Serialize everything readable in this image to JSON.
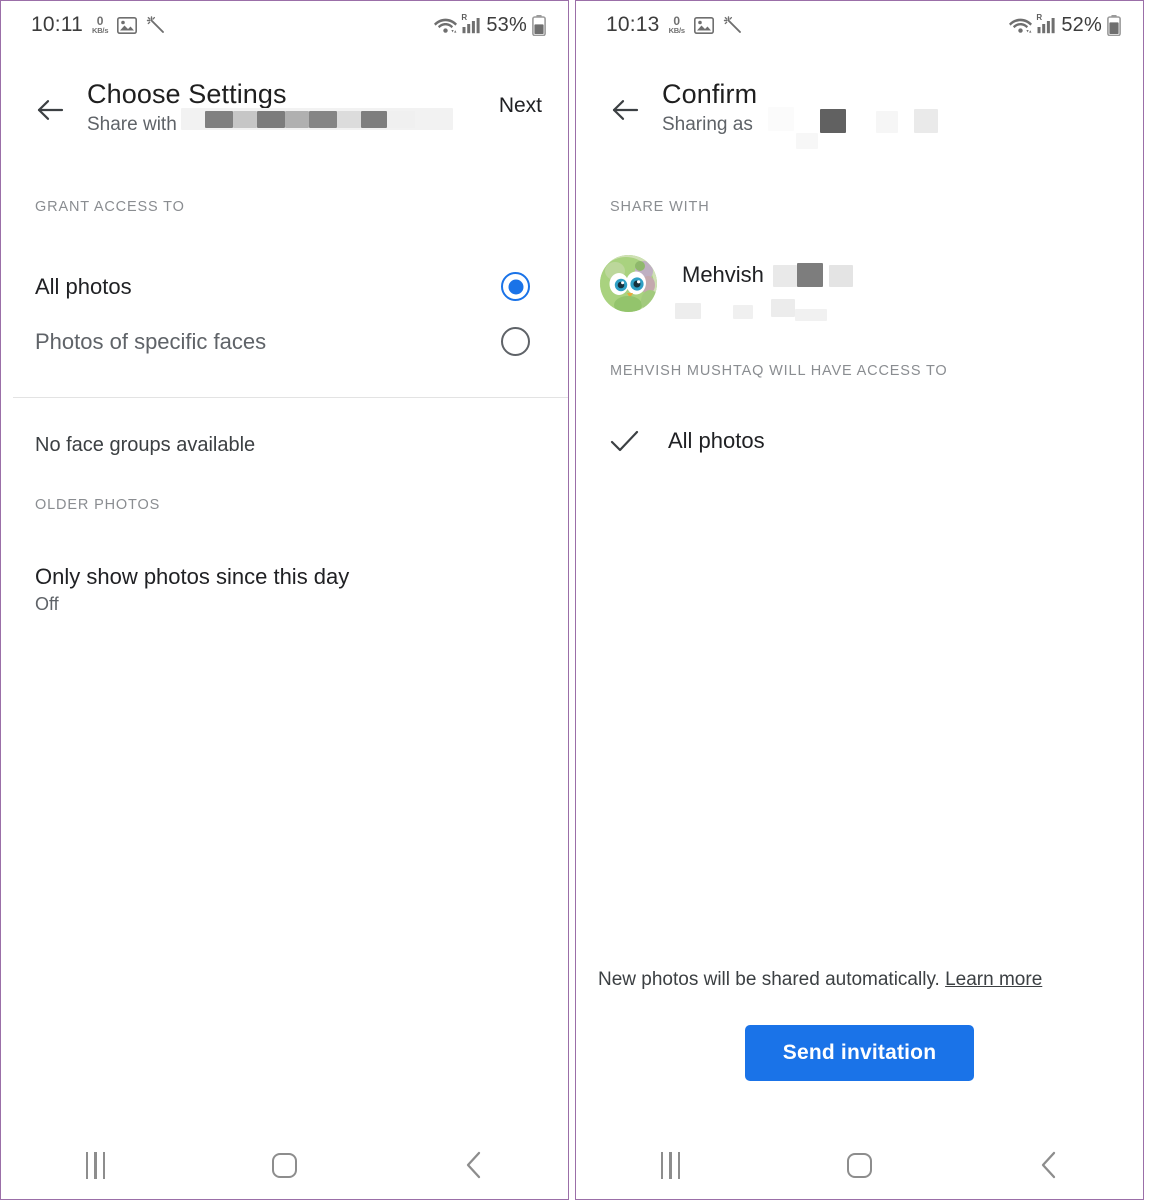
{
  "panels": [
    {
      "id": "choose-settings",
      "status_bar": {
        "time": "10:11",
        "data_rate_value": "0",
        "data_rate_unit": "KB/s",
        "icons": [
          "image-icon",
          "magic-wand-icon",
          "wifi-icon",
          "signal-icon"
        ],
        "roaming_indicator": "R",
        "battery_percent": "53%"
      },
      "app_bar": {
        "back_icon": "arrow-left-icon",
        "title": "Choose Settings",
        "subtitle": "Share with",
        "subtitle_redacted": true,
        "action_label": "Next"
      },
      "sections": [
        {
          "label": "GRANT ACCESS TO",
          "options": [
            {
              "label": "All photos",
              "selected": true
            },
            {
              "label": "Photos of specific faces",
              "selected": false
            }
          ],
          "note": "No face groups available"
        },
        {
          "label": "OLDER PHOTOS",
          "setting": {
            "title": "Only show photos since this day",
            "value": "Off"
          }
        }
      ],
      "nav_bar": {
        "recents_label": "recent-apps",
        "home_label": "home",
        "back_label": "back"
      }
    },
    {
      "id": "confirm",
      "status_bar": {
        "time": "10:13",
        "data_rate_value": "0",
        "data_rate_unit": "KB/s",
        "icons": [
          "image-icon",
          "magic-wand-icon",
          "wifi-icon",
          "signal-icon"
        ],
        "roaming_indicator": "R",
        "battery_percent": "52%"
      },
      "app_bar": {
        "back_icon": "arrow-left-icon",
        "title": "Confirm",
        "subtitle": "Sharing as",
        "subtitle_redacted": true,
        "action_label": ""
      },
      "share_with": {
        "label": "SHARE WITH",
        "person_name": "Mehvish",
        "person_name_redacted": true,
        "avatar": "cartoon-bird-avatar"
      },
      "access": {
        "label": "MEHVISH MUSHTAQ WILL HAVE ACCESS TO",
        "item_label": "All photos",
        "item_icon": "check-icon"
      },
      "footer": {
        "note": "New photos will be shared automatically.",
        "link": "Learn more",
        "cta_label": "Send invitation"
      },
      "nav_bar": {
        "recents_label": "recent-apps",
        "home_label": "home",
        "back_label": "back"
      }
    }
  ],
  "colors": {
    "accent_blue": "#1a73e8",
    "frame_purple": "#9b6fa8",
    "text_primary": "#202124",
    "text_secondary": "#5f6368",
    "divider": "#e3e3e3"
  }
}
